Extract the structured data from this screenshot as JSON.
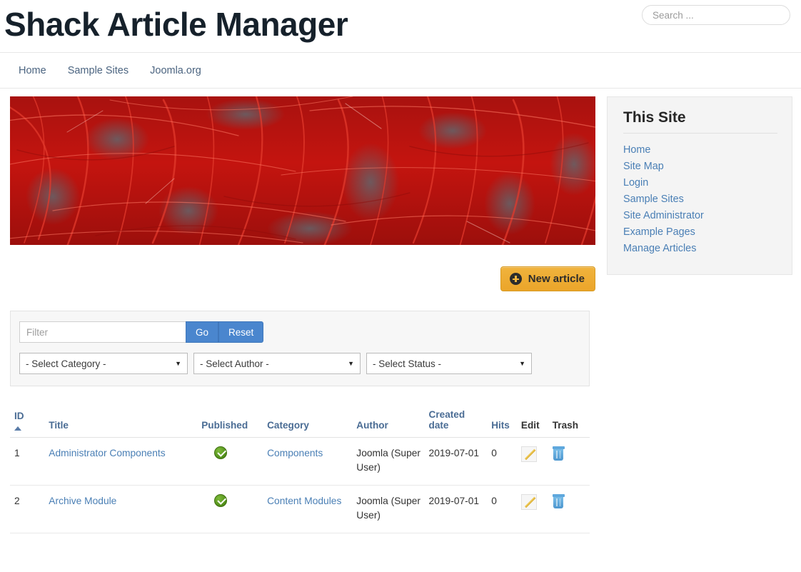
{
  "header": {
    "site_title": "Shack Article Manager",
    "search_placeholder": "Search ..."
  },
  "navbar": {
    "items": [
      {
        "label": "Home"
      },
      {
        "label": "Sample Sites"
      },
      {
        "label": "Joomla.org"
      }
    ]
  },
  "hero": {
    "alt": "Red Japanese maple foliage banner",
    "dominant_color": "#c0140f",
    "shadow_color": "#6d7076"
  },
  "toolbar": {
    "new_article_label": "New article"
  },
  "filter": {
    "input_placeholder": "Filter",
    "go_label": "Go",
    "reset_label": "Reset",
    "category_selected": "- Select Category -",
    "author_selected": "- Select Author -",
    "status_selected": "- Select Status -",
    "caret": "▼"
  },
  "table": {
    "headers": {
      "id": "ID",
      "title": "Title",
      "published": "Published",
      "category": "Category",
      "author": "Author",
      "created_date": "Created date",
      "created_date_line1": "Created",
      "created_date_line2": "date",
      "hits": "Hits",
      "edit": "Edit",
      "trash": "Trash"
    },
    "sort_column": "id",
    "sort_direction": "ascending",
    "rows": [
      {
        "id": "1",
        "title": "Administrator Components",
        "published": "published",
        "category": "Components",
        "author": "Joomla (Super User)",
        "created_date": "2019-07-01",
        "hits": "0",
        "edit": "edit-icon",
        "trash": "trash-icon"
      },
      {
        "id": "2",
        "title": "Archive Module",
        "published": "published",
        "category": "Content Modules",
        "author": "Joomla (Super User)",
        "created_date": "2019-07-01",
        "hits": "0",
        "edit": "edit-icon",
        "trash": "trash-icon"
      }
    ]
  },
  "sidebar": {
    "module_title": "This Site",
    "items": [
      {
        "label": "Home"
      },
      {
        "label": "Site Map"
      },
      {
        "label": "Login"
      },
      {
        "label": "Sample Sites"
      },
      {
        "label": "Site Administrator"
      },
      {
        "label": "Example Pages"
      },
      {
        "label": "Manage Articles"
      }
    ]
  },
  "colors": {
    "link": "#4a7fb5",
    "nav_link": "#4b6480",
    "button_primary": "#4a86ce",
    "button_accent": "#eba52a",
    "published_green": "#4e8a17",
    "trash_blue": "#5fa8dd"
  }
}
